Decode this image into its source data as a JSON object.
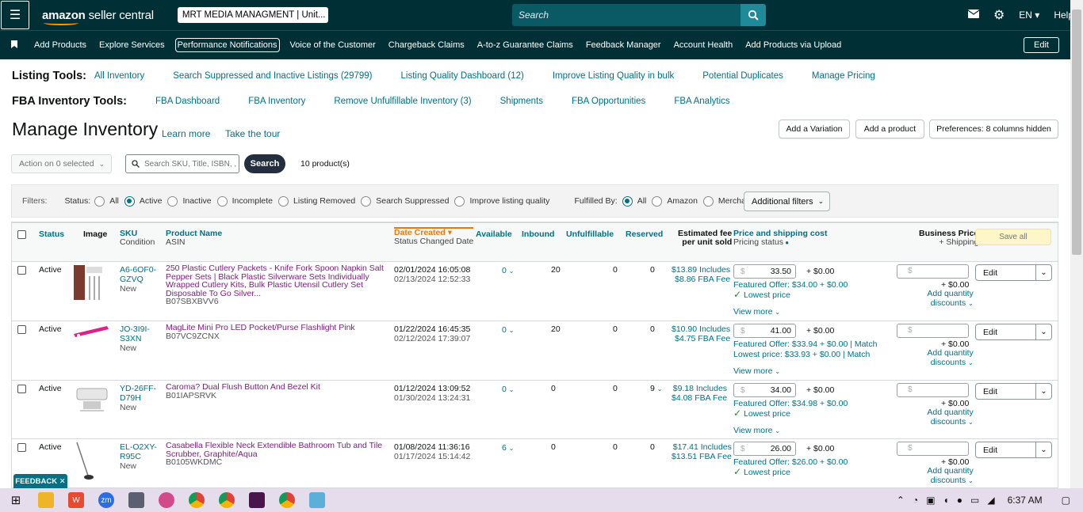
{
  "topbar": {
    "logo": "amazon",
    "logo_suffix": " seller central",
    "store": "MRT MEDIA MANAGMENT | Unit...",
    "search_placeholder": "Search",
    "lang": "EN",
    "help": "Help"
  },
  "nav": {
    "items": [
      "Add Products",
      "Explore Services",
      "Performance Notifications",
      "Voice of the Customer",
      "Chargeback Claims",
      "A-to-z Guarantee Claims",
      "Feedback Manager",
      "Account Health",
      "Add Products via Upload"
    ],
    "edit": "Edit"
  },
  "listing_tools": {
    "label": "Listing Tools:",
    "links": [
      "All Inventory",
      "Search Suppressed and Inactive Listings (29799)",
      "Listing Quality Dashboard (12)",
      "Improve Listing Quality in bulk",
      "Potential Duplicates",
      "Manage Pricing"
    ]
  },
  "fba_tools": {
    "label": "FBA Inventory Tools:",
    "links": [
      "FBA Dashboard",
      "FBA Inventory",
      "Remove Unfulfillable Inventory (3)",
      "Shipments",
      "FBA Opportunities",
      "FBA Analytics"
    ]
  },
  "page": {
    "title": "Manage Inventory",
    "learn_more": "Learn more",
    "take_tour": "Take the tour",
    "add_variation": "Add a Variation",
    "add_product": "Add a product",
    "preferences": "Preferences: 8 columns hidden",
    "action": "Action on 0 selected",
    "sku_placeholder": "Search SKU, Title, ISBN, ,",
    "search": "Search",
    "count": "10 product(s)"
  },
  "filters": {
    "label": "Filters:",
    "status_label": "Status:",
    "status_options": [
      "All",
      "Active",
      "Inactive",
      "Incomplete",
      "Listing Removed",
      "Search Suppressed",
      "Improve listing quality"
    ],
    "fulfilled_label": "Fulfilled By:",
    "fulfilled_options": [
      "All",
      "Amazon",
      "Merchant"
    ],
    "additional": "Additional filters"
  },
  "columns": {
    "status": "Status",
    "image": "Image",
    "sku": "SKU",
    "condition": "Condition",
    "product_name": "Product Name",
    "asin": "ASIN",
    "date_created": "Date Created",
    "status_changed": "Status Changed Date",
    "available": "Available",
    "inbound": "Inbound",
    "unfulfillable": "Unfulfillable",
    "reserved": "Reserved",
    "est_fee_1": "Estimated fee",
    "est_fee_2": "per unit sold",
    "price": "Price and shipping cost",
    "pricing_status": "Pricing status",
    "business_price": "Business Price",
    "plus_shipping": "+ Shipping",
    "save_all": "Save all"
  },
  "rows": [
    {
      "status": "Active",
      "sku1": "A6-6OF0-",
      "sku2": "GZVQ",
      "condition": "New",
      "name": "250 Plastic Cutlery Packets - Knife Fork Spoon Napkin Salt Pepper Sets | Black Plastic Silverware Sets Individually Wrapped Cutlery Kits, Bulk Plastic Utensil Cutlery Set Disposable To Go Silver...",
      "asin": "B07SBXBVV6",
      "created": "02/01/2024 16:05:08",
      "changed": "02/13/2024 12:52:33",
      "available": "0",
      "inbound": "20",
      "unfulfillable": "0",
      "reserved": "0",
      "fee1": "$13.89 Includes",
      "fee2": "$8.86 FBA Fee",
      "price": "33.50",
      "shipping": "+ $0.00",
      "featured": "Featured Offer: $34.00 + $0.00",
      "lowest": "Lowest price",
      "lowest_price": "",
      "view_more": "View more",
      "biz_ship": "+ $0.00",
      "add_qty": "Add quantity",
      "discounts": "discounts",
      "edit": "Edit"
    },
    {
      "status": "Active",
      "sku1": "JO-3I9I-",
      "sku2": "S3XN",
      "condition": "New",
      "name": "MagLite Mini Pro LED Pocket/Purse Flashlight Pink",
      "asin": "B07VC9ZCNX",
      "created": "01/22/2024 16:45:35",
      "changed": "02/12/2024 17:39:07",
      "available": "0",
      "inbound": "20",
      "unfulfillable": "0",
      "reserved": "0",
      "fee1": "$10.90 Includes",
      "fee2": "$4.75 FBA Fee",
      "price": "41.00",
      "shipping": "+ $0.00",
      "featured": "Featured Offer: $33.94 + $0.00 | Match",
      "lowest": "",
      "lowest_price": "Lowest price: $33.93 + $0.00 | Match",
      "view_more": "View more",
      "biz_ship": "+ $0.00",
      "add_qty": "Add quantity",
      "discounts": "discounts",
      "edit": "Edit"
    },
    {
      "status": "Active",
      "sku1": "YD-26FF-",
      "sku2": "D79H",
      "condition": "New",
      "name": "Caroma? Dual Flush Button And Bezel Kit",
      "asin": "B01IAPSRVK",
      "created": "01/12/2024 13:09:52",
      "changed": "01/30/2024 13:24:31",
      "available": "0",
      "inbound": "0",
      "unfulfillable": "0",
      "reserved": "9",
      "fee1": "$9.18 Includes",
      "fee2": "$4.08 FBA Fee",
      "price": "34.00",
      "shipping": "+ $0.00",
      "featured": "Featured Offer: $34.98 + $0.00",
      "lowest": "Lowest price",
      "lowest_price": "",
      "view_more": "View more",
      "biz_ship": "+ $0.00",
      "add_qty": "Add quantity",
      "discounts": "discounts",
      "edit": "Edit"
    },
    {
      "status": "Active",
      "sku1": "EL-O2XY-",
      "sku2": "R95C",
      "condition": "New",
      "name": "Casabella Flexible Neck Extendible Bathroom Tub and Tile Scrubber, Graphite/Aqua",
      "asin": "B0105WKDMC",
      "created": "01/08/2024 11:36:16",
      "changed": "01/17/2024 15:14:42",
      "available": "6",
      "inbound": "0",
      "unfulfillable": "0",
      "reserved": "0",
      "fee1": "$17.41 Includes",
      "fee2": "$13.51 FBA Fee",
      "price": "26.00",
      "shipping": "+ $0.00",
      "featured": "Featured Offer: $26.00 + $0.00",
      "lowest": "Lowest price",
      "lowest_price": "",
      "view_more": "",
      "biz_ship": "+ $0.00",
      "add_qty": "Add quantity",
      "discounts": "discounts",
      "edit": "Edit"
    }
  ],
  "currency": "$",
  "feedback": "FEEDBACK",
  "taskbar": {
    "time": "6:37 AM"
  },
  "colors": {
    "header": "#002f36",
    "link": "#007185",
    "product_link": "#7a1c7a",
    "date_sort": "#e47911"
  }
}
